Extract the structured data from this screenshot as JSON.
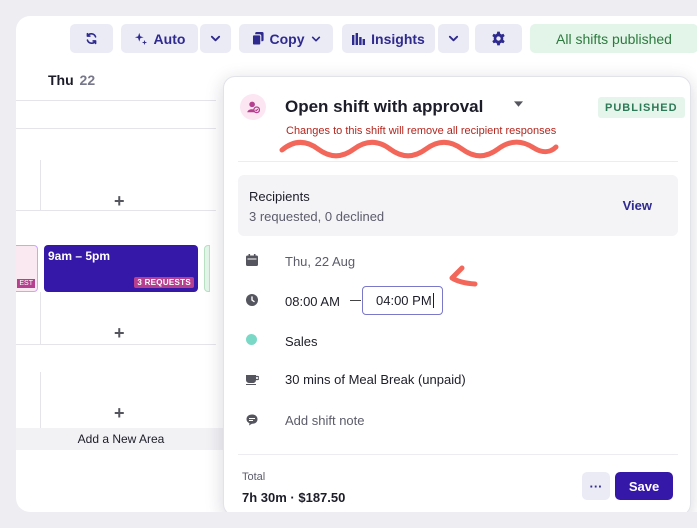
{
  "toolbar": {
    "auto_label": "Auto",
    "copy_label": "Copy",
    "insights_label": "Insights",
    "published_label": "All shifts published"
  },
  "calendar": {
    "day_name": "Thu",
    "day_number": "22",
    "shift_time": "9am – 5pm",
    "shift_requests": "3 REQUESTS",
    "left_tag": "EST",
    "add_area": "Add a New Area",
    "plus": "+"
  },
  "panel": {
    "title": "Open shift with approval",
    "status": "PUBLISHED",
    "warning": "Changes to this shift will remove all recipient responses",
    "recipients": {
      "title": "Recipients",
      "summary": "3 requested, 0 declined",
      "view_label": "View"
    },
    "date": "Thu, 22 Aug",
    "start_time": "08:00 AM",
    "end_time": "04:00 PM",
    "area": "Sales",
    "break": "30 mins of Meal Break (unpaid)",
    "note_placeholder": "Add shift note",
    "footer": {
      "total_label": "Total",
      "total_value": "7h 30m · $187.50",
      "more_label": "···",
      "save_label": "Save"
    }
  },
  "colors": {
    "accent": "#3518a8",
    "accent_soft": "#ebebf6",
    "published_green": "#2d7a3f",
    "warning_red": "#b3261e",
    "annotation": "#f2675a",
    "area_dot": "#7ad9c6"
  }
}
